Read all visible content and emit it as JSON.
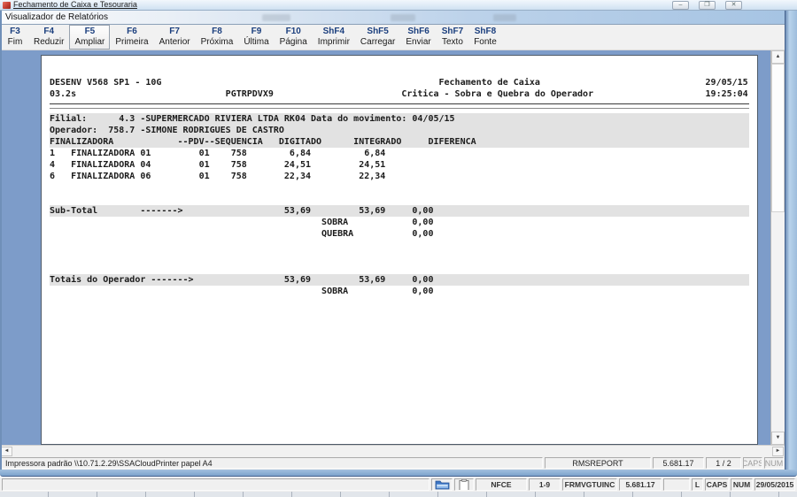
{
  "window": {
    "title": "Fechamento de Caixa e Tesouraria",
    "controls": {
      "minimize": "–",
      "restore": "❐",
      "close": "✕"
    }
  },
  "viewer": {
    "title": "Visualizador de Relatórios",
    "toolbar": [
      {
        "key": "F3",
        "label": "Fim",
        "active": false
      },
      {
        "key": "F4",
        "label": "Reduzir",
        "active": false
      },
      {
        "key": "F5",
        "label": "Ampliar",
        "active": true
      },
      {
        "key": "F6",
        "label": "Primeira",
        "active": false
      },
      {
        "key": "F7",
        "label": "Anterior",
        "active": false
      },
      {
        "key": "F8",
        "label": "Próxima",
        "active": false
      },
      {
        "key": "F9",
        "label": "Última",
        "active": false
      },
      {
        "key": "F10",
        "label": "Página",
        "active": false
      },
      {
        "key": "ShF4",
        "label": "Imprimir",
        "active": false
      },
      {
        "key": "ShF5",
        "label": "Carregar",
        "active": false
      },
      {
        "key": "ShF6",
        "label": "Enviar",
        "active": false
      },
      {
        "key": "ShF7",
        "label": "Texto",
        "active": false
      },
      {
        "key": "ShF8",
        "label": "Fonte",
        "active": false
      }
    ],
    "scrollbar": {
      "up": "▲",
      "down": "▼",
      "left": "◄",
      "right": "►"
    },
    "statusbar": {
      "printer": "Impressora padrão \\\\10.71.2.29\\SSACloudPrinter papel A4",
      "report_name": "RMSREPORT",
      "version": "5.681.17",
      "page": "1 / 2",
      "caps": "CAPS",
      "num": "NUM"
    }
  },
  "report": {
    "lines": [
      {
        "segs": [
          [
            0,
            "DESENV V568 SP1 - 10G"
          ],
          [
            73,
            "Fechamento de Caixa"
          ],
          [
            123,
            "29/05/15"
          ]
        ]
      },
      {
        "segs": [
          [
            0,
            "03.2s"
          ],
          [
            33,
            "PGTRPDVX9"
          ],
          [
            66,
            "Critica - Sobra e Quebra do Operador"
          ],
          [
            123,
            "19:25:04"
          ]
        ]
      },
      {
        "rule": true
      },
      {
        "band": true,
        "segs": [
          [
            0,
            "Filial:"
          ],
          [
            13,
            "4.3 -SUPERMERCADO RIVIERA LTDA RK04"
          ],
          [
            49,
            "Data do movimento: 04/05/15"
          ]
        ]
      },
      {
        "band": true,
        "segs": [
          [
            0,
            "Operador:"
          ],
          [
            11,
            "758.7 -SIMONE RODRIGUES DE CASTRO"
          ]
        ]
      },
      {
        "band": true,
        "segs": [
          [
            0,
            "FINALIZADORA"
          ],
          [
            24,
            "--PDV--SEQUENCIA"
          ],
          [
            43,
            "DIGITADO"
          ],
          [
            57,
            "INTEGRADO"
          ],
          [
            71,
            "DIFERENCA"
          ]
        ]
      },
      {
        "segs": [
          [
            0,
            "1"
          ],
          [
            4,
            "FINALIZADORA 01"
          ],
          [
            28,
            "01"
          ],
          [
            34,
            "758"
          ],
          [
            45,
            "6,84"
          ],
          [
            59,
            "6,84"
          ]
        ]
      },
      {
        "segs": [
          [
            0,
            "4"
          ],
          [
            4,
            "FINALIZADORA 04"
          ],
          [
            28,
            "01"
          ],
          [
            34,
            "758"
          ],
          [
            44,
            "24,51"
          ],
          [
            58,
            "24,51"
          ]
        ]
      },
      {
        "segs": [
          [
            0,
            "6"
          ],
          [
            4,
            "FINALIZADORA 06"
          ],
          [
            28,
            "01"
          ],
          [
            34,
            "758"
          ],
          [
            44,
            "22,34"
          ],
          [
            58,
            "22,34"
          ]
        ]
      },
      {
        "segs": []
      },
      {
        "segs": []
      },
      {
        "band": true,
        "segs": [
          [
            0,
            "Sub-Total"
          ],
          [
            17,
            "------->"
          ],
          [
            44,
            "53,69"
          ],
          [
            58,
            "53,69"
          ],
          [
            68,
            "0,00"
          ]
        ]
      },
      {
        "segs": [
          [
            51,
            "SOBRA"
          ],
          [
            68,
            "0,00"
          ]
        ]
      },
      {
        "segs": [
          [
            51,
            "QUEBRA"
          ],
          [
            68,
            "0,00"
          ]
        ]
      },
      {
        "segs": []
      },
      {
        "segs": []
      },
      {
        "segs": []
      },
      {
        "band": true,
        "segs": [
          [
            0,
            "Totais do Operador"
          ],
          [
            19,
            "------->"
          ],
          [
            44,
            "53,69"
          ],
          [
            58,
            "53,69"
          ],
          [
            68,
            "0,00"
          ]
        ]
      },
      {
        "segs": [
          [
            51,
            "SOBRA"
          ],
          [
            68,
            "0,00"
          ]
        ]
      }
    ]
  },
  "app_statusbar": {
    "cells": [
      {
        "label": "NFCE",
        "dim": false
      },
      {
        "label": "1-9",
        "dim": false
      },
      {
        "label": "FRMVGTUINC",
        "dim": false
      },
      {
        "label": "5.681.17",
        "dim": false
      },
      {
        "label": "",
        "dim": false
      },
      {
        "label": "L",
        "dim": false
      },
      {
        "label": "CAPS",
        "dim": true
      },
      {
        "label": "NUM",
        "dim": true
      },
      {
        "label": "29/05/2015",
        "dim": false
      }
    ]
  }
}
